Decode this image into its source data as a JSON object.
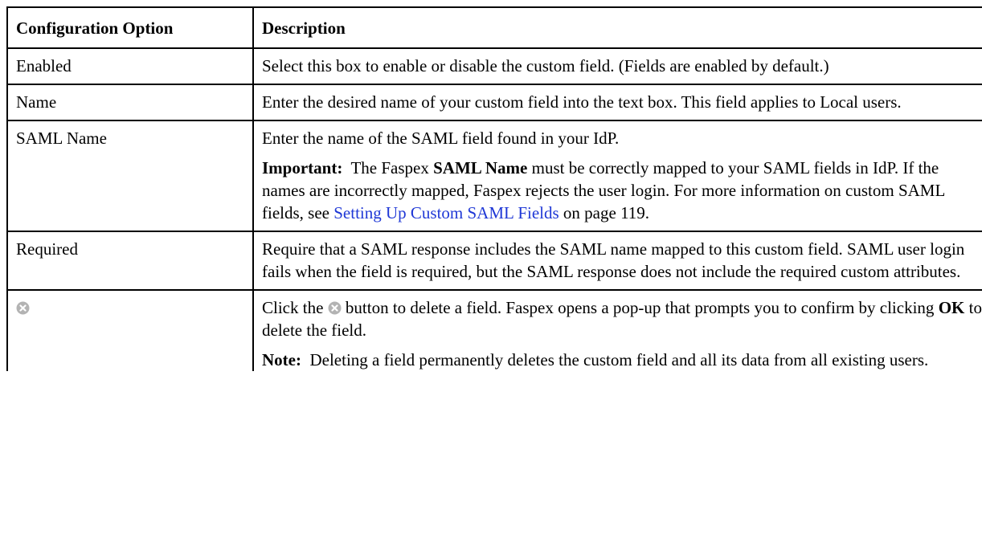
{
  "headers": {
    "option": "Configuration Option",
    "description": "Description"
  },
  "rows": {
    "enabled": {
      "option": "Enabled",
      "description": "Select this box to enable or disable the custom field. (Fields are enabled by default.)"
    },
    "name": {
      "option": "Name",
      "description": "Enter the desired name of your custom field into the text box. This field applies to Local users."
    },
    "saml_name": {
      "option": "SAML Name",
      "description": "Enter the name of the SAML field found in your IdP.",
      "important_label": "Important:",
      "important_pre": "The Faspex",
      "important_term": "SAML Name",
      "important_post": "must be correctly mapped to your SAML fields in IdP. If the names are incorrectly mapped, Faspex rejects the user login. For more information on custom SAML fields, see",
      "link_text": "Setting Up Custom SAML Fields",
      "link_suffix": "on page 119."
    },
    "required": {
      "option": "Required",
      "description": "Require that a SAML response includes the SAML name mapped to this custom field. SAML user login fails when the field is required, but the SAML response does not include the required custom attributes."
    },
    "delete": {
      "option_icon": "delete-circle-icon",
      "click_pre": "Click the",
      "click_post": "button to delete a field. Faspex opens a pop-up that prompts you to confirm by clicking",
      "ok_label": "OK",
      "click_end": "to delete the field.",
      "note_label": "Note:",
      "note_text": "Deleting a field permanently deletes the custom field and all its data from all existing users."
    }
  },
  "colors": {
    "link": "#1f38d6",
    "icon": "#b3b3b3",
    "border": "#000000"
  }
}
